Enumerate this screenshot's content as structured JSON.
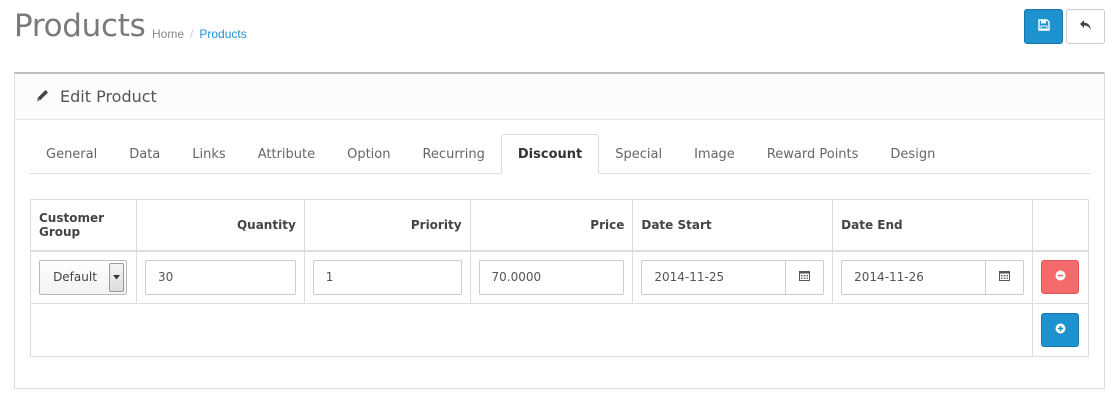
{
  "page": {
    "title": "Products",
    "breadcrumb": {
      "home": "Home",
      "separator": "/",
      "current": "Products"
    }
  },
  "header_buttons": {
    "save_icon": "save-icon",
    "back_icon": "reply-icon"
  },
  "panel": {
    "title": "Edit Product",
    "icon": "pencil-icon"
  },
  "tabs": [
    {
      "label": "General"
    },
    {
      "label": "Data"
    },
    {
      "label": "Links"
    },
    {
      "label": "Attribute"
    },
    {
      "label": "Option"
    },
    {
      "label": "Recurring"
    },
    {
      "label": "Discount",
      "active": true
    },
    {
      "label": "Special"
    },
    {
      "label": "Image"
    },
    {
      "label": "Reward Points"
    },
    {
      "label": "Design"
    }
  ],
  "table": {
    "headers": {
      "customer_group_line1": "Customer",
      "customer_group_line2": "Group",
      "quantity": "Quantity",
      "priority": "Priority",
      "price": "Price",
      "date_start": "Date Start",
      "date_end": "Date End"
    },
    "rows": [
      {
        "customer_group": "Default",
        "quantity": "30",
        "priority": "1",
        "price": "70.0000",
        "date_start": "2014-11-25",
        "date_end": "2014-11-26"
      }
    ]
  },
  "colors": {
    "primary": "#1e91cf",
    "danger": "#f56b6b",
    "link": "#1e91cf"
  }
}
